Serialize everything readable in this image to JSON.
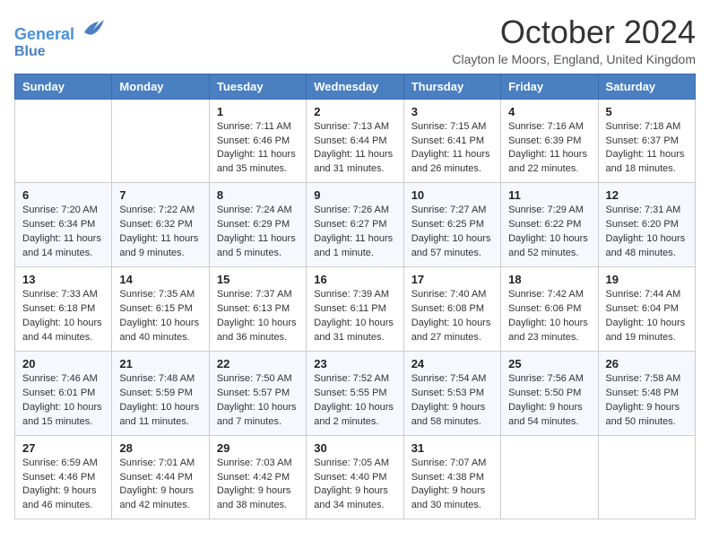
{
  "header": {
    "logo_line1": "General",
    "logo_line2": "Blue",
    "month_title": "October 2024",
    "location": "Clayton le Moors, England, United Kingdom"
  },
  "days_of_week": [
    "Sunday",
    "Monday",
    "Tuesday",
    "Wednesday",
    "Thursday",
    "Friday",
    "Saturday"
  ],
  "weeks": [
    [
      {
        "day": "",
        "info": ""
      },
      {
        "day": "",
        "info": ""
      },
      {
        "day": "1",
        "info": "Sunrise: 7:11 AM\nSunset: 6:46 PM\nDaylight: 11 hours and 35 minutes."
      },
      {
        "day": "2",
        "info": "Sunrise: 7:13 AM\nSunset: 6:44 PM\nDaylight: 11 hours and 31 minutes."
      },
      {
        "day": "3",
        "info": "Sunrise: 7:15 AM\nSunset: 6:41 PM\nDaylight: 11 hours and 26 minutes."
      },
      {
        "day": "4",
        "info": "Sunrise: 7:16 AM\nSunset: 6:39 PM\nDaylight: 11 hours and 22 minutes."
      },
      {
        "day": "5",
        "info": "Sunrise: 7:18 AM\nSunset: 6:37 PM\nDaylight: 11 hours and 18 minutes."
      }
    ],
    [
      {
        "day": "6",
        "info": "Sunrise: 7:20 AM\nSunset: 6:34 PM\nDaylight: 11 hours and 14 minutes."
      },
      {
        "day": "7",
        "info": "Sunrise: 7:22 AM\nSunset: 6:32 PM\nDaylight: 11 hours and 9 minutes."
      },
      {
        "day": "8",
        "info": "Sunrise: 7:24 AM\nSunset: 6:29 PM\nDaylight: 11 hours and 5 minutes."
      },
      {
        "day": "9",
        "info": "Sunrise: 7:26 AM\nSunset: 6:27 PM\nDaylight: 11 hours and 1 minute."
      },
      {
        "day": "10",
        "info": "Sunrise: 7:27 AM\nSunset: 6:25 PM\nDaylight: 10 hours and 57 minutes."
      },
      {
        "day": "11",
        "info": "Sunrise: 7:29 AM\nSunset: 6:22 PM\nDaylight: 10 hours and 52 minutes."
      },
      {
        "day": "12",
        "info": "Sunrise: 7:31 AM\nSunset: 6:20 PM\nDaylight: 10 hours and 48 minutes."
      }
    ],
    [
      {
        "day": "13",
        "info": "Sunrise: 7:33 AM\nSunset: 6:18 PM\nDaylight: 10 hours and 44 minutes."
      },
      {
        "day": "14",
        "info": "Sunrise: 7:35 AM\nSunset: 6:15 PM\nDaylight: 10 hours and 40 minutes."
      },
      {
        "day": "15",
        "info": "Sunrise: 7:37 AM\nSunset: 6:13 PM\nDaylight: 10 hours and 36 minutes."
      },
      {
        "day": "16",
        "info": "Sunrise: 7:39 AM\nSunset: 6:11 PM\nDaylight: 10 hours and 31 minutes."
      },
      {
        "day": "17",
        "info": "Sunrise: 7:40 AM\nSunset: 6:08 PM\nDaylight: 10 hours and 27 minutes."
      },
      {
        "day": "18",
        "info": "Sunrise: 7:42 AM\nSunset: 6:06 PM\nDaylight: 10 hours and 23 minutes."
      },
      {
        "day": "19",
        "info": "Sunrise: 7:44 AM\nSunset: 6:04 PM\nDaylight: 10 hours and 19 minutes."
      }
    ],
    [
      {
        "day": "20",
        "info": "Sunrise: 7:46 AM\nSunset: 6:01 PM\nDaylight: 10 hours and 15 minutes."
      },
      {
        "day": "21",
        "info": "Sunrise: 7:48 AM\nSunset: 5:59 PM\nDaylight: 10 hours and 11 minutes."
      },
      {
        "day": "22",
        "info": "Sunrise: 7:50 AM\nSunset: 5:57 PM\nDaylight: 10 hours and 7 minutes."
      },
      {
        "day": "23",
        "info": "Sunrise: 7:52 AM\nSunset: 5:55 PM\nDaylight: 10 hours and 2 minutes."
      },
      {
        "day": "24",
        "info": "Sunrise: 7:54 AM\nSunset: 5:53 PM\nDaylight: 9 hours and 58 minutes."
      },
      {
        "day": "25",
        "info": "Sunrise: 7:56 AM\nSunset: 5:50 PM\nDaylight: 9 hours and 54 minutes."
      },
      {
        "day": "26",
        "info": "Sunrise: 7:58 AM\nSunset: 5:48 PM\nDaylight: 9 hours and 50 minutes."
      }
    ],
    [
      {
        "day": "27",
        "info": "Sunrise: 6:59 AM\nSunset: 4:46 PM\nDaylight: 9 hours and 46 minutes."
      },
      {
        "day": "28",
        "info": "Sunrise: 7:01 AM\nSunset: 4:44 PM\nDaylight: 9 hours and 42 minutes."
      },
      {
        "day": "29",
        "info": "Sunrise: 7:03 AM\nSunset: 4:42 PM\nDaylight: 9 hours and 38 minutes."
      },
      {
        "day": "30",
        "info": "Sunrise: 7:05 AM\nSunset: 4:40 PM\nDaylight: 9 hours and 34 minutes."
      },
      {
        "day": "31",
        "info": "Sunrise: 7:07 AM\nSunset: 4:38 PM\nDaylight: 9 hours and 30 minutes."
      },
      {
        "day": "",
        "info": ""
      },
      {
        "day": "",
        "info": ""
      }
    ]
  ]
}
